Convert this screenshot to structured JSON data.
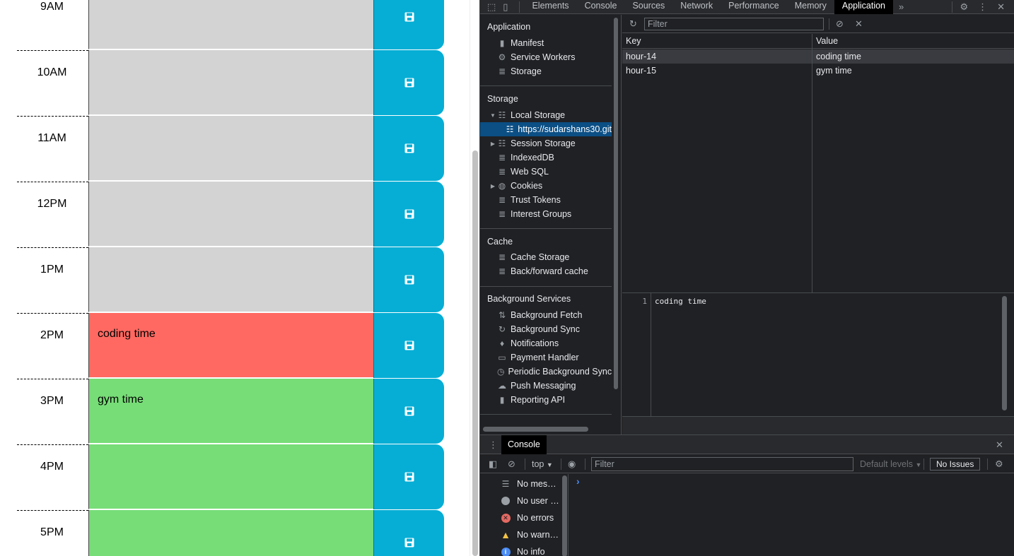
{
  "planner": {
    "rows": [
      {
        "hour": "9AM",
        "text": "",
        "state": "past"
      },
      {
        "hour": "10AM",
        "text": "",
        "state": "past"
      },
      {
        "hour": "11AM",
        "text": "",
        "state": "past"
      },
      {
        "hour": "12PM",
        "text": "",
        "state": "past"
      },
      {
        "hour": "1PM",
        "text": "",
        "state": "past"
      },
      {
        "hour": "2PM",
        "text": "coding time",
        "state": "present"
      },
      {
        "hour": "3PM",
        "text": "gym time",
        "state": "future"
      },
      {
        "hour": "4PM",
        "text": "",
        "state": "future"
      },
      {
        "hour": "5PM",
        "text": "",
        "state": "future"
      }
    ],
    "colors": {
      "past": "#d3d3d3",
      "present": "#ff6961",
      "future": "#77dd77",
      "save": "#06aed5"
    }
  },
  "devtools": {
    "tabs": [
      "Elements",
      "Console",
      "Sources",
      "Network",
      "Performance",
      "Memory",
      "Application"
    ],
    "active_tab": "Application",
    "sidebar": {
      "application": {
        "title": "Application",
        "items": [
          {
            "label": "Manifest",
            "icon": "document-icon"
          },
          {
            "label": "Service Workers",
            "icon": "gear-icon"
          },
          {
            "label": "Storage",
            "icon": "database-icon"
          }
        ]
      },
      "storage": {
        "title": "Storage",
        "items": [
          {
            "label": "Local Storage",
            "icon": "grid-icon"
          },
          {
            "label": "https://sudarshans30.git",
            "icon": "grid-icon"
          },
          {
            "label": "Session Storage",
            "icon": "grid-icon"
          },
          {
            "label": "IndexedDB",
            "icon": "database-icon"
          },
          {
            "label": "Web SQL",
            "icon": "database-icon"
          },
          {
            "label": "Cookies",
            "icon": "cookie-icon"
          },
          {
            "label": "Trust Tokens",
            "icon": "database-icon"
          },
          {
            "label": "Interest Groups",
            "icon": "database-icon"
          }
        ]
      },
      "cache": {
        "title": "Cache",
        "items": [
          {
            "label": "Cache Storage",
            "icon": "database-icon"
          },
          {
            "label": "Back/forward cache",
            "icon": "database-icon"
          }
        ]
      },
      "background": {
        "title": "Background Services",
        "items": [
          {
            "label": "Background Fetch",
            "icon": "arrows-icon"
          },
          {
            "label": "Background Sync",
            "icon": "sync-icon"
          },
          {
            "label": "Notifications",
            "icon": "bell-icon"
          },
          {
            "label": "Payment Handler",
            "icon": "card-icon"
          },
          {
            "label": "Periodic Background Sync",
            "icon": "clock-icon"
          },
          {
            "label": "Push Messaging",
            "icon": "cloud-icon"
          },
          {
            "label": "Reporting API",
            "icon": "document-icon"
          }
        ]
      }
    },
    "local_storage": {
      "filter_placeholder": "Filter",
      "columns": [
        "Key",
        "Value"
      ],
      "entries": [
        {
          "key": "hour-14",
          "value": "coding time"
        },
        {
          "key": "hour-15",
          "value": "gym time"
        }
      ],
      "preview": {
        "line": "1",
        "text": "coding time"
      }
    },
    "console": {
      "tab": "Console",
      "context": "top",
      "filter_placeholder": "Filter",
      "levels": "Default levels",
      "issues": "No Issues",
      "prompt": "›",
      "messages": [
        {
          "label": "No mes…",
          "icon": "list-icon"
        },
        {
          "label": "No user …",
          "icon": "user-icon"
        },
        {
          "label": "No errors",
          "icon": "error-icon"
        },
        {
          "label": "No warn…",
          "icon": "warning-icon"
        },
        {
          "label": "No info",
          "icon": "info-icon"
        }
      ]
    }
  }
}
